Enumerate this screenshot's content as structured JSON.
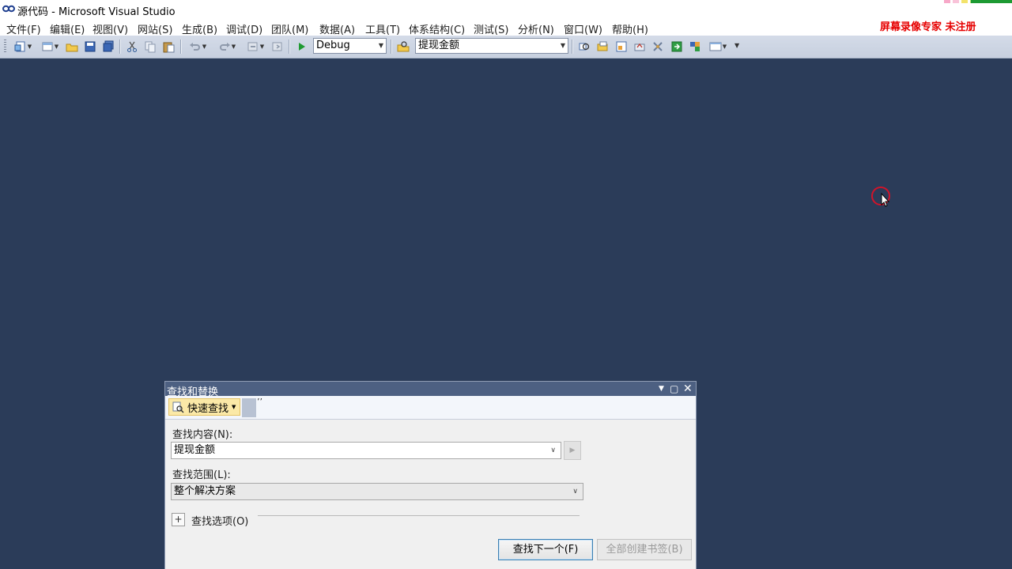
{
  "window": {
    "title": "源代码 - Microsoft Visual Studio",
    "icon": "visual-studio-logo"
  },
  "watermark": "屏幕录像专家  未注册",
  "menu": [
    "文件(F)",
    "编辑(E)",
    "视图(V)",
    "网站(S)",
    "生成(B)",
    "调试(D)",
    "团队(M)",
    "数据(A)",
    "工具(T)",
    "体系结构(C)",
    "测试(S)",
    "分析(N)",
    "窗口(W)",
    "帮助(H)"
  ],
  "toolbar": {
    "configuration": "Debug",
    "find_combo": "提现金额",
    "icons": [
      "new-project-icon",
      "add-item-icon",
      "open-file-icon",
      "save-icon",
      "save-all-icon",
      "cut-icon",
      "copy-icon",
      "paste-icon",
      "undo-icon",
      "redo-icon",
      "navigate-backward-icon",
      "navigate-forward-icon",
      "start-debugging-icon",
      "find-in-files-icon",
      "solution-explorer-icon",
      "properties-icon",
      "object-browser-icon",
      "toolbox-icon",
      "team-explorer-icon",
      "start-page-icon",
      "class-view-icon",
      "output-icon"
    ]
  },
  "find_dialog": {
    "title": "查找和替换",
    "mode_button": "快速查找",
    "find_label": "查找内容(N):",
    "find_value": "提现金额",
    "scope_label": "查找范围(L):",
    "scope_value": "整个解决方案",
    "options_label": "查找选项(O)",
    "find_next": "查找下一个(F)",
    "bookmark_all": "全部创建书签(B)"
  },
  "colors": {
    "workspace": "#2b3c59",
    "dialog_title": "#4d6082",
    "watermark": "#e60000",
    "highlight": "#fbe9a7"
  }
}
